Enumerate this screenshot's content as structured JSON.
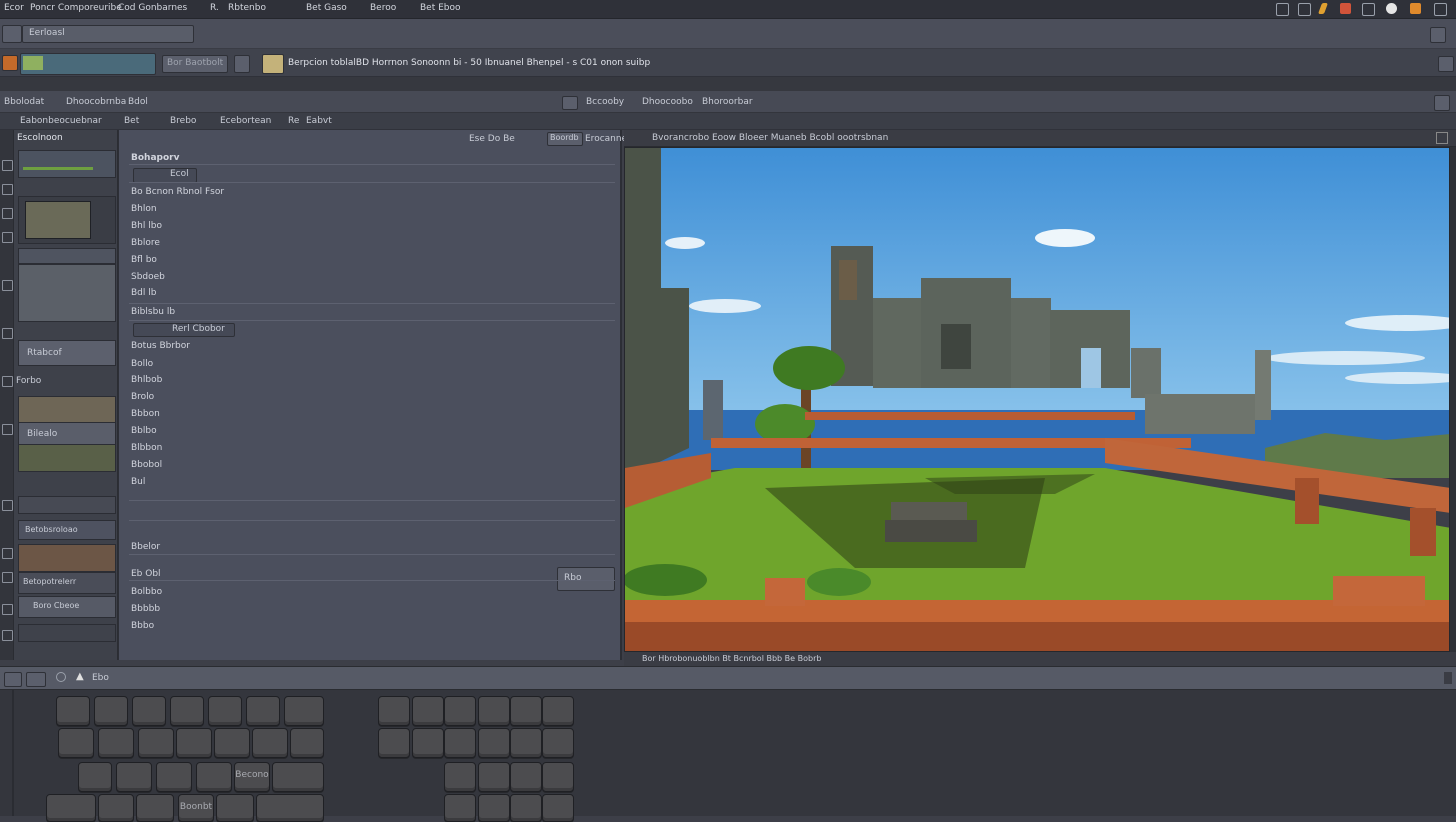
{
  "menubar": {
    "items": [
      "Ecor",
      "Poncr Comporeuribe",
      "Cod Gonbarnes",
      "R.",
      "Rbtenbo",
      "Bet Gaso",
      "Beroo",
      "Bet Eboo"
    ],
    "colors": {
      "accent_orange": "#e08a2c",
      "accent_red": "#c94b34"
    }
  },
  "toolbar1": {
    "tab_label": "Eerloasl",
    "field_text": "Bor Baotbolt"
  },
  "toolbar2": {
    "title": "Berpcion toblalBD Horrnon Sonoonn bi - 50 Ibnuanel Bhenpel - s C01 onon suibp"
  },
  "toolbar4": {
    "left_items": [
      "Bbolodat",
      "Dhoocobrnba",
      "Bdol"
    ],
    "right_items": [
      "Bccooby",
      "Dhoocoobo",
      "Bhoroorbar"
    ]
  },
  "toolbar5": {
    "items": [
      "Eabonbeocuebnar",
      "Bet",
      "Brebo",
      "Ecebortean",
      "Re",
      "Eabvt"
    ],
    "right_items": [
      "Ese Do Be",
      "Boordb",
      "Erocanne"
    ],
    "viewport_title": "Bvorancrobo Eoow Bloeer Muaneb Bcobl oootrsbnan"
  },
  "assets_panel": {
    "header": "Escolnoon",
    "labels": [
      "Rtabcof",
      "Forbo",
      "Bilealo",
      "Betobsroloao",
      "Betopotrelerr",
      "Boro Cbeoe"
    ]
  },
  "properties": {
    "section1": {
      "title": "Bohaporv",
      "field": "Ecol",
      "sub_title": "Bo Bcnon Rbnol Fsor",
      "rows": [
        "Bhlon",
        "Bhl lbo",
        "Bblore",
        "Bfl bo",
        "Sbdoeb",
        "Bdl lb"
      ]
    },
    "section2": {
      "title": "Biblsbu lb",
      "field": "Rerl Cbobor",
      "sub_title": "Botus Bbrbor",
      "rows": [
        "Bollo",
        "Bhlbob",
        "Brolo",
        "Bbbon",
        "Bblbo",
        "Blbbon",
        "Bbobol",
        "Bul"
      ]
    },
    "section3": {
      "title": "Bbelor",
      "field": "Eb Obl",
      "rows": [
        "Bolbbo",
        "Bbbbb",
        "Bbbo"
      ],
      "button_label": "Rbo"
    }
  },
  "viewport": {
    "status_text": "Bor Hbrobonuoblbn Bt Bcnrbol Bbb Be Bobrb",
    "scene": "voxel castle with grassy courtyard"
  },
  "bottombar": {
    "label": "Ebo"
  },
  "keyboard": {
    "keys_left": [
      "",
      "",
      "",
      "",
      "",
      "",
      "",
      "",
      "",
      "",
      "",
      "",
      "",
      "",
      "",
      "",
      "",
      "",
      "Becono",
      "",
      "",
      "",
      "",
      "Boonbt"
    ],
    "keys_right": [
      "",
      "",
      "",
      "",
      "",
      "",
      "",
      "",
      "",
      "",
      "",
      "",
      "",
      "",
      "",
      "",
      "",
      "",
      "",
      "",
      "",
      ""
    ]
  }
}
